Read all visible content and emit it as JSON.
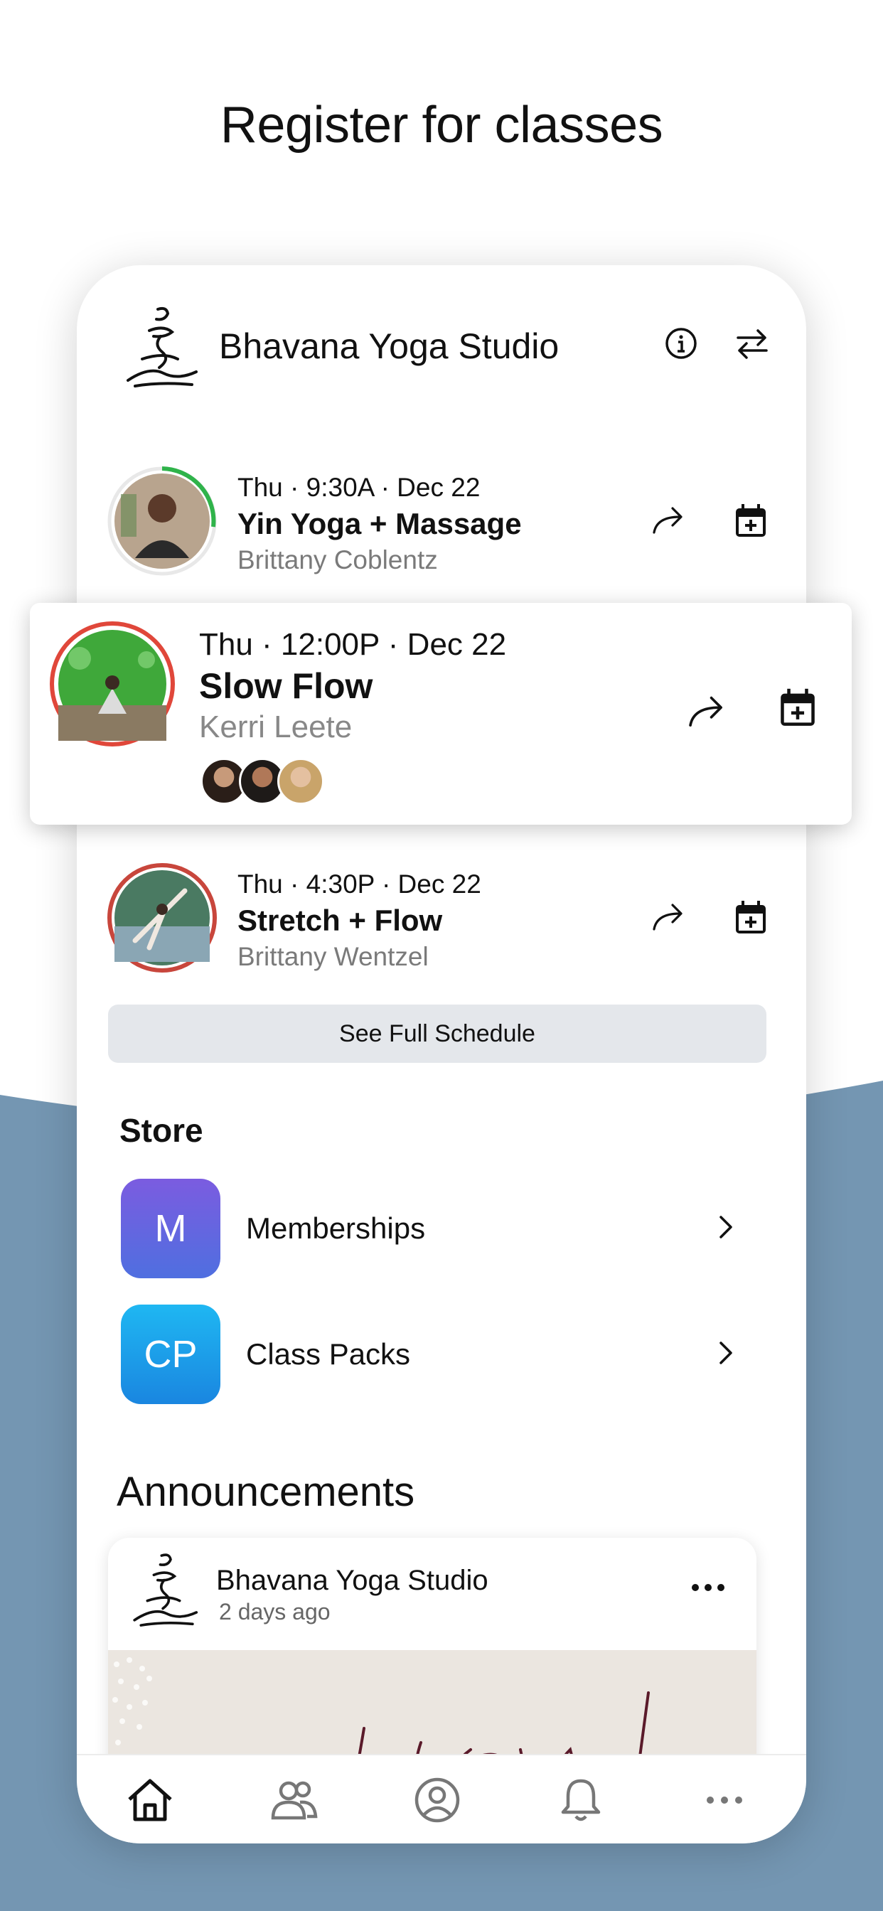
{
  "headline": "Register for classes",
  "studio": {
    "name": "Bhavana Yoga Studio",
    "info_icon": "info-icon",
    "switch_icon": "switch-arrows-icon"
  },
  "classes": [
    {
      "time": "Thu · 9:30A · Dec 22",
      "title": "Yin Yoga + Massage",
      "teacher": "Brittany Coblentz",
      "ring_color": "#2fb34a"
    },
    {
      "time": "Thu · 12:00P · Dec 22",
      "title": "Slow Flow",
      "teacher": "Kerri Leete",
      "ring_color": "#e0473a",
      "attendee_count_shown": 3
    },
    {
      "time": "Thu · 4:30P · Dec 22",
      "title": "Stretch + Flow",
      "teacher": "Brittany Wentzel",
      "ring_color": "#c8463c"
    }
  ],
  "schedule_button": "See Full Schedule",
  "store": {
    "title": "Store",
    "items": [
      {
        "initials": "M",
        "label": "Memberships",
        "color_top": "#7b5ce0",
        "color_bottom": "#4f6fe0"
      },
      {
        "initials": "CP",
        "label": "Class Packs",
        "color_top": "#1fb7f2",
        "color_bottom": "#1a86e0"
      }
    ]
  },
  "announcements": {
    "title": "Announcements",
    "post": {
      "author": "Bhavana Yoga Studio",
      "time": "2 days ago"
    }
  },
  "tabs": [
    "home-icon",
    "people-icon",
    "profile-icon",
    "bell-icon",
    "more-icon"
  ],
  "colors": {
    "background_band": "#7496b2",
    "schedule_button_bg": "#e4e7eb"
  }
}
